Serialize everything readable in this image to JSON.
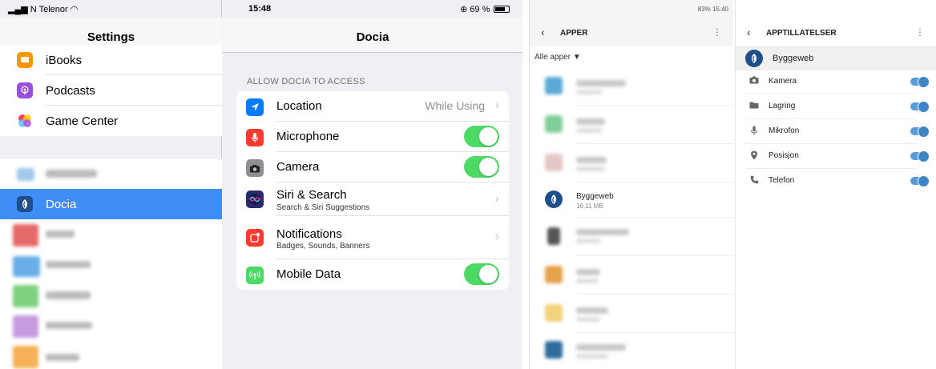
{
  "ipad": {
    "status": {
      "carrier": "N Telenor",
      "time": "15:48",
      "battery": "69 %"
    },
    "master": {
      "title": "Settings",
      "items": [
        {
          "label": "iBooks",
          "icon": "ibooks-icon",
          "color": "#ff9500"
        },
        {
          "label": "Podcasts",
          "icon": "podcasts-icon",
          "color": "#9b4de0"
        },
        {
          "label": "Game Center",
          "icon": "game-center-icon",
          "color": "#ff3b6b"
        }
      ],
      "selected": {
        "label": "Docia",
        "icon": "docia-icon"
      }
    },
    "detail": {
      "title": "Docia",
      "section_header": "ALLOW DOCIA TO ACCESS",
      "rows": [
        {
          "label": "Location",
          "value": "While Using",
          "icon": "location-icon",
          "color": "#007aff"
        },
        {
          "label": "Microphone",
          "icon": "microphone-icon",
          "color": "#ff3b30",
          "enabled": true
        },
        {
          "label": "Camera",
          "icon": "camera-icon",
          "color": "#8e8e93",
          "enabled": true
        },
        {
          "label": "Siri & Search",
          "sub": "Search & Siri Suggestions",
          "icon": "siri-icon",
          "color": "#2a2a6e"
        },
        {
          "label": "Notifications",
          "sub": "Badges, Sounds, Banners",
          "icon": "notifications-icon",
          "color": "#ff3b30"
        },
        {
          "label": "Mobile Data",
          "icon": "mobile-data-icon",
          "color": "#4cd964",
          "enabled": true
        }
      ]
    }
  },
  "android_apps": {
    "status": "83% 15:40",
    "title": "APPER",
    "filter": "Alle apper",
    "visible_app": {
      "name": "Byggeweb",
      "size": "16,11 MB"
    }
  },
  "android_permissions": {
    "title": "APPTILLATELSER",
    "app_name": "Byggeweb",
    "permissions": [
      {
        "label": "Kamera",
        "icon": "camera-icon",
        "enabled": true
      },
      {
        "label": "Lagring",
        "icon": "folder-icon",
        "enabled": true
      },
      {
        "label": "Mikrofon",
        "icon": "microphone-icon",
        "enabled": true
      },
      {
        "label": "Posisjon",
        "icon": "location-pin-icon",
        "enabled": true
      },
      {
        "label": "Telefon",
        "icon": "phone-icon",
        "enabled": true
      }
    ]
  }
}
